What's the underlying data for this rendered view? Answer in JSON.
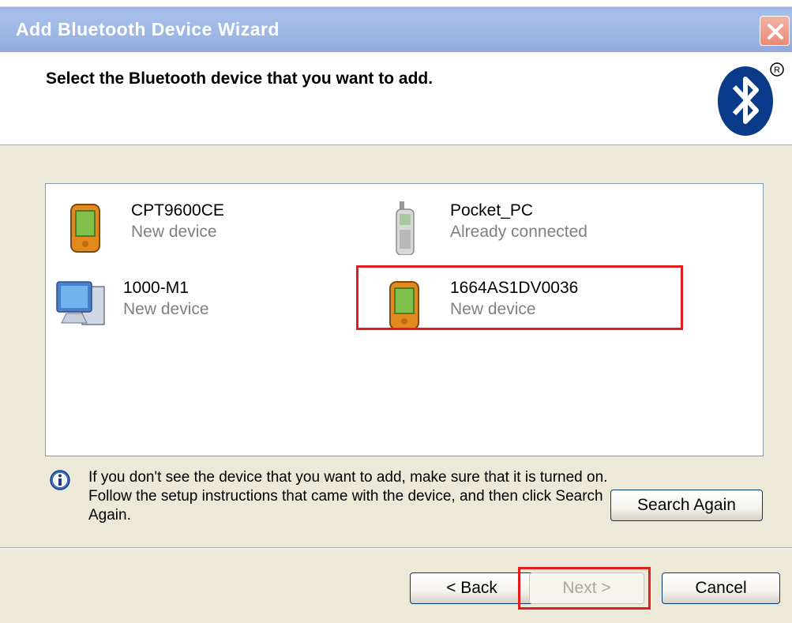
{
  "window": {
    "title": "Add Bluetooth Device Wizard"
  },
  "header": {
    "heading": "Select the Bluetooth device that you want to add."
  },
  "devices": [
    {
      "name": "CPT9600CE",
      "status": "New device",
      "icon": "pda-icon"
    },
    {
      "name": "Pocket_PC",
      "status": "Already connected",
      "icon": "phone-icon"
    },
    {
      "name": "1000-M1",
      "status": "New device",
      "icon": "computer-icon"
    },
    {
      "name": "1664AS1DV0036",
      "status": "New device",
      "icon": "pda-icon"
    }
  ],
  "info": {
    "text": "If you don't see the device that you want to add, make sure that it is turned on. Follow the setup instructions that came with the device, and then click Search Again."
  },
  "buttons": {
    "search_again": "Search Again",
    "back": "< Back",
    "next": "Next >",
    "cancel": "Cancel"
  },
  "colors": {
    "highlight": "#e41c1c",
    "titlebar": "#9db6e5",
    "dialog_bg": "#ece9d8"
  }
}
